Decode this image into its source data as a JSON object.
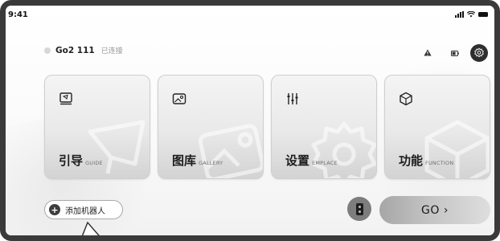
{
  "status_bar": {
    "time": "9:41"
  },
  "header": {
    "device_name": "Go2 111",
    "connection_status": "已连接",
    "icons": [
      "warning-icon",
      "battery-icon",
      "settings-gear-icon"
    ]
  },
  "cards": [
    {
      "title": "引导",
      "subtitle": "GUIDE",
      "icon": "guide-book-icon"
    },
    {
      "title": "图库",
      "subtitle": "GALLERY",
      "icon": "gallery-image-icon"
    },
    {
      "title": "设置",
      "subtitle": "EMPLACE",
      "icon": "settings-sliders-icon"
    },
    {
      "title": "功能",
      "subtitle": "FUNCTION",
      "icon": "function-cube-icon"
    }
  ],
  "footer": {
    "add_robot_label": "添加机器人",
    "go_label": "GO ›"
  },
  "colors": {
    "card_gradient_top": "#f4f4f4",
    "card_gradient_bottom": "#d3d3d3",
    "dark_button": "#2e2e2e",
    "go_button": "#c4c4c4"
  }
}
